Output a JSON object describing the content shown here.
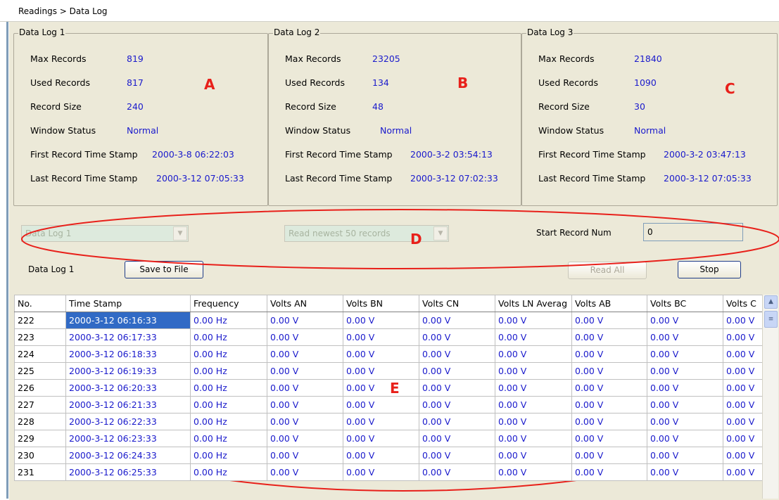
{
  "breadcrumb": "Readings > Data Log",
  "logs": [
    {
      "title": "Data Log 1",
      "max_label": "Max Records",
      "max": "819",
      "used_label": "Used Records",
      "used": "817",
      "size_label": "Record Size",
      "size": "240",
      "window_label": "Window Status",
      "window": "Normal",
      "first_label": "First Record Time Stamp",
      "first": "2000-3-8 06:22:03",
      "last_label": "Last Record Time Stamp",
      "last": "2000-3-12 07:05:33",
      "annotation": "A"
    },
    {
      "title": "Data Log 2",
      "max_label": "Max Records",
      "max": "23205",
      "used_label": "Used Records",
      "used": "134",
      "size_label": "Record Size",
      "size": "48",
      "window_label": "Window Status",
      "window": "Normal",
      "first_label": "First Record Time Stamp",
      "first": "2000-3-2 03:54:13",
      "last_label": "Last Record Time Stamp",
      "last": "2000-3-12 07:02:33",
      "annotation": "B"
    },
    {
      "title": "Data Log 3",
      "max_label": "Max Records",
      "max": "21840",
      "used_label": "Used Records",
      "used": "1090",
      "size_label": "Record Size",
      "size": "30",
      "window_label": "Window Status",
      "window": "Normal",
      "first_label": "First Record Time Stamp",
      "first": "2000-3-2 03:47:13",
      "last_label": "Last Record Time Stamp",
      "last": "2000-3-12 07:05:33",
      "annotation": "C"
    }
  ],
  "controls": {
    "log_select": "Data Log 1",
    "records_select": "Read newest 50 records",
    "start_label": "Start Record Num",
    "start_value": "0",
    "current_log_label": "Data Log 1",
    "save_button": "Save to File",
    "read_all_button": "Read All",
    "stop_button": "Stop",
    "annotation": "D"
  },
  "table_annotation": "E",
  "table": {
    "columns": [
      "No.",
      "Time Stamp",
      "Frequency",
      "Volts AN",
      "Volts BN",
      "Volts CN",
      "Volts LN Averag",
      "Volts AB",
      "Volts BC",
      "Volts C"
    ],
    "rows": [
      [
        "222",
        "2000-3-12 06:16:33",
        "0.00 Hz",
        "0.00 V",
        "0.00 V",
        "0.00 V",
        "0.00 V",
        "0.00 V",
        "0.00 V",
        "0.00 V"
      ],
      [
        "223",
        "2000-3-12 06:17:33",
        "0.00 Hz",
        "0.00 V",
        "0.00 V",
        "0.00 V",
        "0.00 V",
        "0.00 V",
        "0.00 V",
        "0.00 V"
      ],
      [
        "224",
        "2000-3-12 06:18:33",
        "0.00 Hz",
        "0.00 V",
        "0.00 V",
        "0.00 V",
        "0.00 V",
        "0.00 V",
        "0.00 V",
        "0.00 V"
      ],
      [
        "225",
        "2000-3-12 06:19:33",
        "0.00 Hz",
        "0.00 V",
        "0.00 V",
        "0.00 V",
        "0.00 V",
        "0.00 V",
        "0.00 V",
        "0.00 V"
      ],
      [
        "226",
        "2000-3-12 06:20:33",
        "0.00 Hz",
        "0.00 V",
        "0.00 V",
        "0.00 V",
        "0.00 V",
        "0.00 V",
        "0.00 V",
        "0.00 V"
      ],
      [
        "227",
        "2000-3-12 06:21:33",
        "0.00 Hz",
        "0.00 V",
        "0.00 V",
        "0.00 V",
        "0.00 V",
        "0.00 V",
        "0.00 V",
        "0.00 V"
      ],
      [
        "228",
        "2000-3-12 06:22:33",
        "0.00 Hz",
        "0.00 V",
        "0.00 V",
        "0.00 V",
        "0.00 V",
        "0.00 V",
        "0.00 V",
        "0.00 V"
      ],
      [
        "229",
        "2000-3-12 06:23:33",
        "0.00 Hz",
        "0.00 V",
        "0.00 V",
        "0.00 V",
        "0.00 V",
        "0.00 V",
        "0.00 V",
        "0.00 V"
      ],
      [
        "230",
        "2000-3-12 06:24:33",
        "0.00 Hz",
        "0.00 V",
        "0.00 V",
        "0.00 V",
        "0.00 V",
        "0.00 V",
        "0.00 V",
        "0.00 V"
      ],
      [
        "231",
        "2000-3-12 06:25:33",
        "0.00 Hz",
        "0.00 V",
        "0.00 V",
        "0.00 V",
        "0.00 V",
        "0.00 V",
        "0.00 V",
        "0.00 V"
      ]
    ]
  },
  "icons": {
    "dropdown": "chevron-down-icon",
    "scroll_up": "chevron-up-icon",
    "scroll_thumb": "grip-icon"
  },
  "colors": {
    "value_text": "#1a1acc",
    "annotation": "#e8201a",
    "selection": "#316ac5",
    "panel": "#ece9d8"
  }
}
